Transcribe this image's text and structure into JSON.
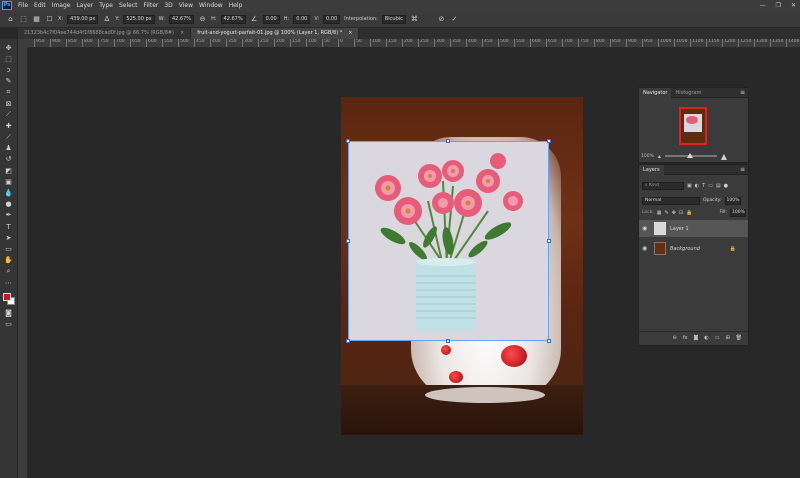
{
  "menu": [
    "File",
    "Edit",
    "Image",
    "Layer",
    "Type",
    "Select",
    "Filter",
    "3D",
    "View",
    "Window",
    "Help"
  ],
  "app_logo": "Ps",
  "window_controls": [
    "—",
    "❐",
    "✕"
  ],
  "options": {
    "x_label": "X:",
    "x_value": "439.00 px",
    "y_label": "Y:",
    "y_value": "525.00 px",
    "w_label": "W:",
    "w_value": "42.67%",
    "h_label": "H:",
    "h_value": "42.67%",
    "angle_value": "0.00",
    "hskew_label": "H:",
    "hskew_value": "0.00",
    "vskew_label": "V:",
    "vskew_value": "0.00",
    "interp_label": "Interpolation:",
    "interp_value": "Bicubic"
  },
  "tabs": [
    {
      "label": "21323b4c7f04ee744d4f1f8688cad0f.jpg @ 66.7% (RGB/8#)",
      "close": "×"
    },
    {
      "label": "fruit-and-yogurt-parfait-01.jpg @ 100% (Layer 1, RGB/8) *",
      "close": "×"
    }
  ],
  "ruler_ticks": [
    "950",
    "900",
    "850",
    "800",
    "750",
    "700",
    "650",
    "600",
    "550",
    "500",
    "450",
    "400",
    "350",
    "300",
    "250",
    "200",
    "150",
    "100",
    "50",
    "0",
    "50",
    "100",
    "150",
    "200",
    "250",
    "300",
    "350",
    "400",
    "450",
    "500",
    "550",
    "600",
    "650",
    "700",
    "750",
    "800",
    "850",
    "900",
    "950",
    "1000",
    "1050",
    "1100",
    "1150",
    "1200",
    "1250",
    "1300",
    "1350",
    "1400",
    "1450",
    "1500",
    "1550",
    "1600"
  ],
  "navigator": {
    "tabs": [
      "Navigator",
      "Histogram"
    ],
    "zoom": "100%"
  },
  "layers_panel": {
    "title": "Layers",
    "kind_label": "Kind",
    "blend_mode": "Normal",
    "opacity_label": "Opacity:",
    "opacity_value": "100%",
    "lock_label": "Lock:",
    "fill_label": "Fill:",
    "fill_value": "100%",
    "layers": [
      {
        "name": "Layer 1",
        "visible": true,
        "selected": true
      },
      {
        "name": "Background",
        "visible": true,
        "selected": false,
        "locked": true
      }
    ]
  },
  "colors": {
    "selection": "#2f6fd5",
    "foreground": "#c8191e",
    "background": "#ffffff"
  }
}
